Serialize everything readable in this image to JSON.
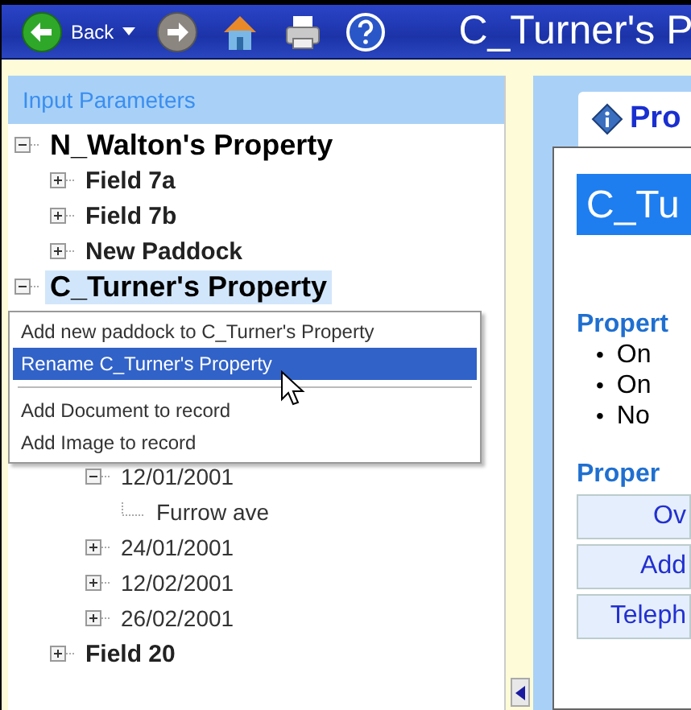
{
  "toolbar": {
    "back_label": "Back",
    "title": "C_Turner's P"
  },
  "sidebar": {
    "title": "Input Parameters",
    "tree": [
      {
        "label": "N_Walton's Property",
        "kind": "property",
        "expanded": true,
        "selected": false,
        "children": [
          {
            "label": "Field 7a",
            "kind": "field",
            "expanded": false,
            "selected": false
          },
          {
            "label": "Field 7b",
            "kind": "field",
            "expanded": false,
            "selected": false
          },
          {
            "label": "New Paddock",
            "kind": "field",
            "expanded": false,
            "selected": false
          }
        ]
      },
      {
        "label": "C_Turner's Property",
        "kind": "property",
        "expanded": true,
        "selected": true,
        "children": [
          {
            "kind": "covered",
            "children": [
              {
                "label": "12/01/2001",
                "kind": "date",
                "expanded": true,
                "selected": false,
                "children": [
                  {
                    "label": "Furrow ave",
                    "kind": "leaf",
                    "selected": false
                  }
                ]
              },
              {
                "label": "24/01/2001",
                "kind": "date",
                "expanded": false,
                "selected": false
              },
              {
                "label": "12/02/2001",
                "kind": "date",
                "expanded": false,
                "selected": false
              },
              {
                "label": "26/02/2001",
                "kind": "date",
                "expanded": false,
                "selected": false
              }
            ]
          },
          {
            "label": "Field 20",
            "kind": "field",
            "expanded": false,
            "selected": false
          }
        ]
      }
    ]
  },
  "context_menu": {
    "groups": [
      [
        {
          "label": "Add new paddock to C_Turner's Property",
          "selected": false
        },
        {
          "label": "Rename C_Turner's Property",
          "selected": true
        }
      ],
      [
        {
          "label": "Add Document to record",
          "selected": false
        },
        {
          "label": "Add Image to record",
          "selected": false
        }
      ]
    ]
  },
  "details": {
    "tab": "Pro",
    "heading": "C_Tu",
    "section_1": {
      "title": "Propert",
      "marker": "•",
      "bullets": [
        "On",
        "On",
        "No"
      ]
    },
    "section_2": {
      "title": "Proper",
      "rows": [
        "Ov",
        "Add",
        "Teleph"
      ]
    }
  }
}
